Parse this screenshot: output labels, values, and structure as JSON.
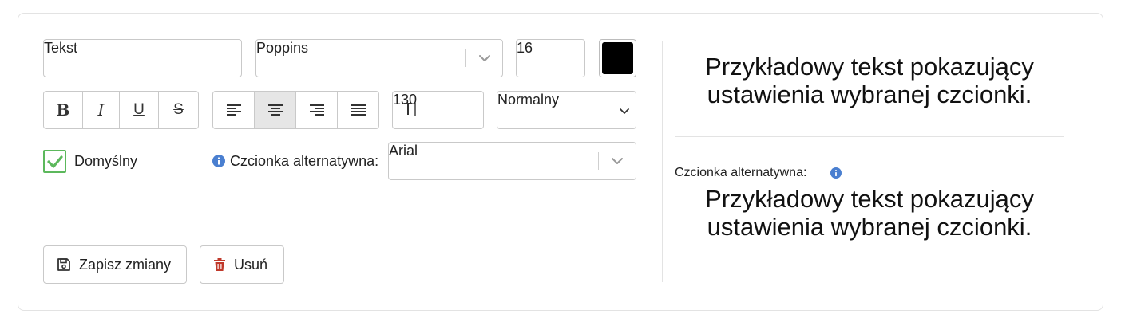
{
  "editor": {
    "text_field_value": "Tekst",
    "font_select_value": "Poppins",
    "font_size_value": "16",
    "color_swatch": "#000000",
    "format_buttons": [
      "B",
      "I",
      "U",
      "S"
    ],
    "line_height_value": "130",
    "weight_select_value": "Normalny",
    "default_checkbox_label": "Domyślny",
    "fallback_label": "Czcionka alternatywna:",
    "fallback_select_value": "Arial",
    "save_label": "Zapisz zmiany",
    "delete_label": "Usuń"
  },
  "preview": {
    "main_text_line1": "Przykładowy tekst pokazujący",
    "main_text_line2": "ustawienia wybranej czcionki.",
    "fallback_caption": "Czcionka alternatywna:",
    "fallback_text_line1": "Przykładowy tekst pokazujący",
    "fallback_text_line2": "ustawienia wybranej czcionki."
  },
  "colors": {
    "checkbox_green": "#5cb85c",
    "info_blue": "#4a7fd0",
    "delete_red": "#c0392b"
  }
}
